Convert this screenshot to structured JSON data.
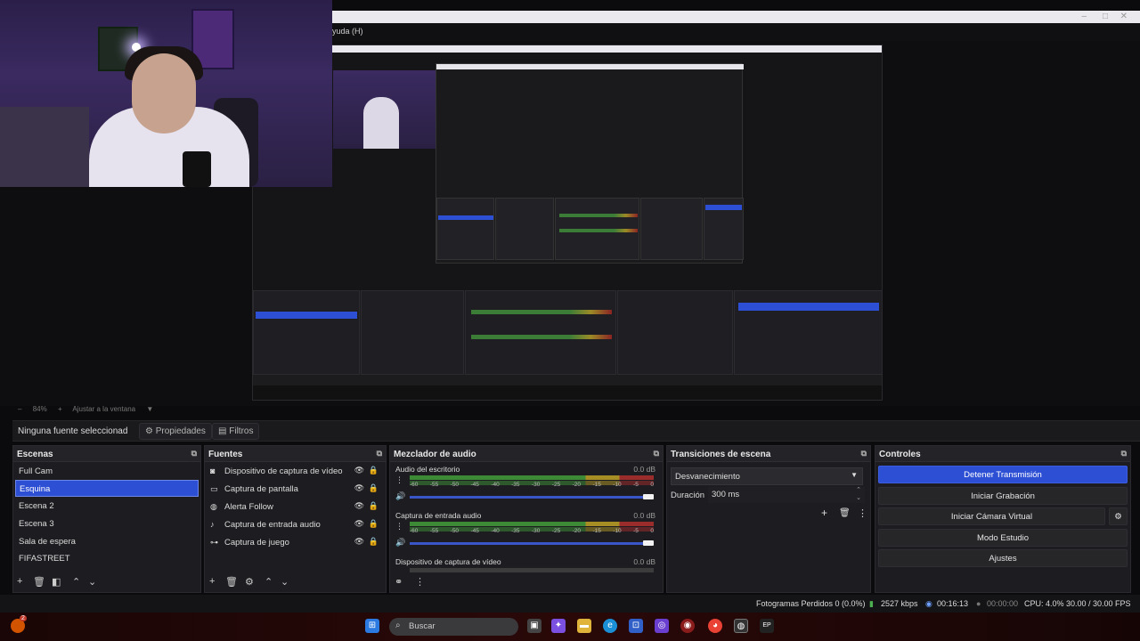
{
  "menubar": {
    "help_menu": "yuda (H)"
  },
  "zoom": {
    "minus": "–",
    "percent": "84%",
    "plus": "+",
    "fit_label": "Ajustar a la ventana",
    "caret": "▼"
  },
  "propbar": {
    "no_source_label": "Ninguna fuente seleccionad",
    "properties_label": "Propiedades",
    "filters_label": "Filtros"
  },
  "scenes": {
    "title": "Escenas",
    "items": [
      "Full Cam",
      "Esquina",
      "Escena 2",
      "Escena 3",
      "Sala de espera",
      "FIFASTREET"
    ],
    "selected_index": 1
  },
  "sources": {
    "title": "Fuentes",
    "items": [
      {
        "label": "Dispositivo de captura de vídeo",
        "icon": "camera-icon"
      },
      {
        "label": "Captura de pantalla",
        "icon": "monitor-icon"
      },
      {
        "label": "Alerta Follow",
        "icon": "globe-icon"
      },
      {
        "label": "Captura de entrada audio",
        "icon": "microphone-icon"
      },
      {
        "label": "Captura de juego",
        "icon": "gamepad-icon"
      }
    ]
  },
  "mixer": {
    "title": "Mezclador de audio",
    "channels": [
      {
        "name": "Audio del escritorio",
        "db": "0.0 dB"
      },
      {
        "name": "Captura de entrada audio",
        "db": "0.0 dB"
      },
      {
        "name": "Dispositivo de captura de vídeo",
        "db": "0.0 dB"
      }
    ],
    "ticks": [
      "-60",
      "-55",
      "-50",
      "-45",
      "-40",
      "-35",
      "-30",
      "-25",
      "-20",
      "-15",
      "-10",
      "-5",
      "0"
    ]
  },
  "transitions": {
    "title": "Transiciones de escena",
    "selected": "Desvanecimiento",
    "duration_label": "Duración",
    "duration_value": "300 ms"
  },
  "controls": {
    "title": "Controles",
    "buttons": [
      "Detener Transmisión",
      "Iniciar Grabación",
      "Iniciar Cámara Virtual",
      "Modo Estudio",
      "Ajustes"
    ]
  },
  "status": {
    "dropped_frames": "Fotogramas Perdidos 0 (0.0%)",
    "bitrate": "2527 kbps",
    "stream_time": "00:16:13",
    "rec_time": "00:00:00",
    "cpu": "CPU: 4.0%",
    "fps": "30.00 / 30.00 FPS"
  },
  "taskbar": {
    "search_placeholder": "Buscar",
    "notification_count": "2"
  },
  "colors": {
    "accent": "#2d4fd4",
    "panel": "#1d1d21",
    "meter_green": "#3c8a36",
    "meter_yellow": "#a68e24",
    "meter_red": "#9a2c2c"
  }
}
